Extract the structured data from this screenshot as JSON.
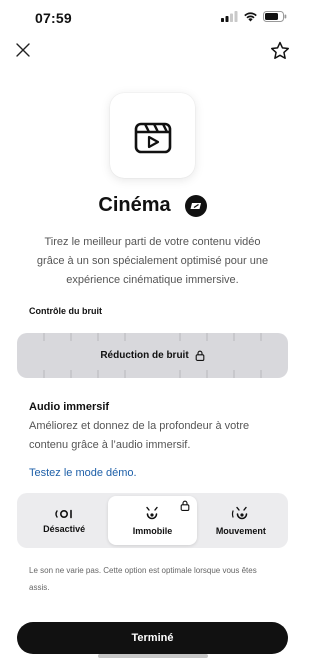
{
  "status": {
    "time": "07:59"
  },
  "icons": {
    "close": "close-icon",
    "favorite": "star-icon",
    "app": "clapperboard-play-icon",
    "brand": "bose-badge-icon",
    "lock": "lock-icon"
  },
  "mode": {
    "title": "Cinéma",
    "description": "Tirez le meilleur parti de votre contenu vidéo grâce à un son spécialement optimisé pour une expérience cinématique immersive."
  },
  "noise_control": {
    "section_label": "Contrôle du bruit",
    "value_label": "Réduction de bruit"
  },
  "immersive_audio": {
    "title": "Audio immersif",
    "description": "Améliorez et donnez de la profondeur à votre contenu grâce à l’audio immersif.",
    "demo_link": "Testez le mode démo.",
    "options": [
      {
        "label": "Désactivé",
        "icon": "audio-off-icon",
        "selected": false,
        "locked": false
      },
      {
        "label": "Immobile",
        "icon": "audio-still-icon",
        "selected": true,
        "locked": true
      },
      {
        "label": "Mouvement",
        "icon": "audio-motion-icon",
        "selected": false,
        "locked": false
      }
    ],
    "note": "Le son ne varie pas. Cette option est optimale lorsque vous êtes assis."
  },
  "footer": {
    "done_label": "Terminé"
  },
  "colors": {
    "accent_link": "#1d5fa8",
    "button_bg": "#111111",
    "card_bg": "#d8d8dc"
  }
}
